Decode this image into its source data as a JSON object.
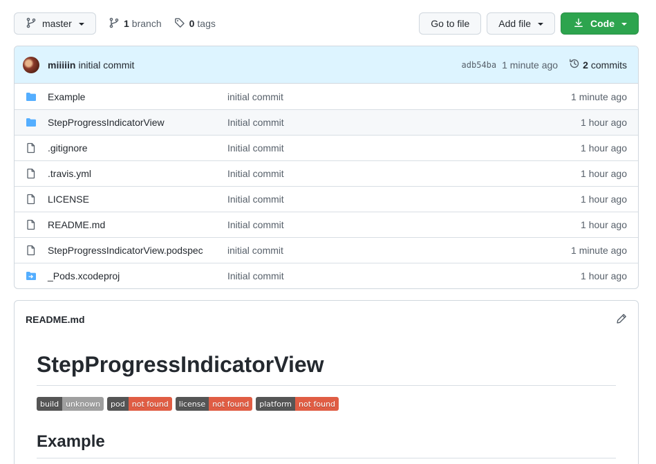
{
  "toolbar": {
    "branch_label": "master",
    "branches_count": "1",
    "branches_text": "branch",
    "tags_count": "0",
    "tags_text": "tags",
    "goto_file": "Go to file",
    "add_file": "Add file",
    "code": "Code"
  },
  "latest_commit": {
    "author": "miiiiin",
    "message": "initial commit",
    "sha": "adb54ba",
    "time": "1 minute ago",
    "commits_count": "2",
    "commits_text": "commits"
  },
  "files": [
    {
      "name": "Example",
      "type": "folder",
      "message": "initial commit",
      "age": "1 minute ago"
    },
    {
      "name": "StepProgressIndicatorView",
      "type": "folder",
      "message": "Initial commit",
      "age": "1 hour ago"
    },
    {
      "name": ".gitignore",
      "type": "file",
      "message": "Initial commit",
      "age": "1 hour ago"
    },
    {
      "name": ".travis.yml",
      "type": "file",
      "message": "Initial commit",
      "age": "1 hour ago"
    },
    {
      "name": "LICENSE",
      "type": "file",
      "message": "Initial commit",
      "age": "1 hour ago"
    },
    {
      "name": "README.md",
      "type": "file",
      "message": "Initial commit",
      "age": "1 hour ago"
    },
    {
      "name": "StepProgressIndicatorView.podspec",
      "type": "file",
      "message": "initial commit",
      "age": "1 minute ago"
    },
    {
      "name": "_Pods.xcodeproj",
      "type": "symlink-folder",
      "message": "Initial commit",
      "age": "1 hour ago"
    }
  ],
  "readme": {
    "filename": "README.md",
    "title": "StepProgressIndicatorView",
    "badges": [
      {
        "key": "build",
        "value": "unknown",
        "color": "#9f9f9f"
      },
      {
        "key": "pod",
        "value": "not found",
        "color": "#e05d44"
      },
      {
        "key": "license",
        "value": "not found",
        "color": "#e05d44"
      },
      {
        "key": "platform",
        "value": "not found",
        "color": "#e05d44"
      }
    ],
    "section_heading": "Example"
  },
  "colors": {
    "accent_green": "#2da44e",
    "commit_bar": "#ddf4ff",
    "folder_icon": "#54aeff"
  }
}
